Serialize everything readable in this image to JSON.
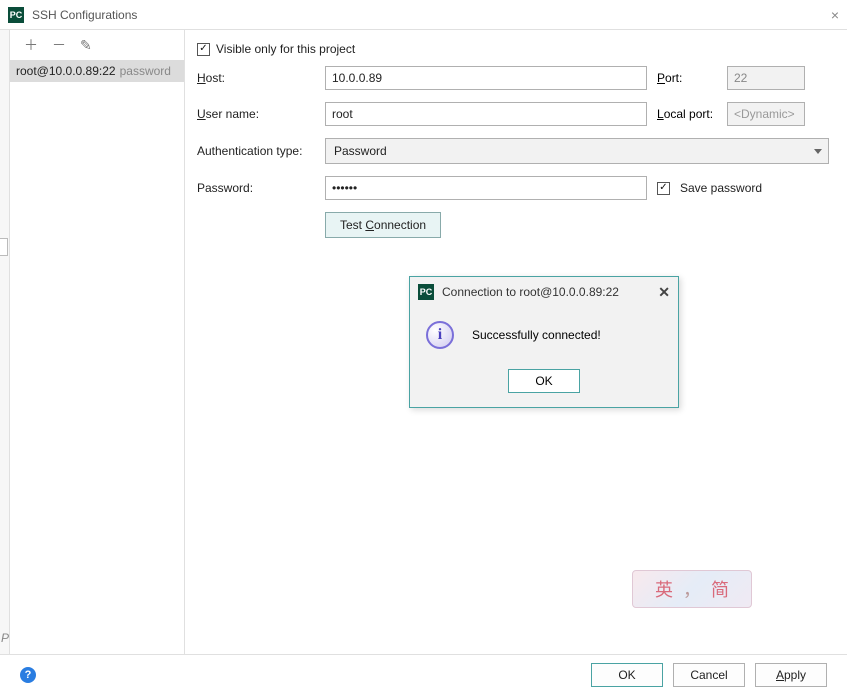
{
  "window": {
    "title": "SSH Configurations",
    "close_glyph": "×"
  },
  "app_icon_text": "PC",
  "sidebar": {
    "icons": {
      "add": "＋",
      "remove": "－",
      "edit": "✎"
    },
    "items": [
      {
        "label": "root@10.0.0.89:22",
        "suffix": "password"
      }
    ]
  },
  "form": {
    "visible_only_label": "Visible only for this project",
    "visible_only_checked": true,
    "host_label": "Host:",
    "host_value": "10.0.0.89",
    "port_label": "Port:",
    "port_value": "22",
    "user_label": "User name:",
    "user_value": "root",
    "localport_label": "Local port:",
    "localport_placeholder": "<Dynamic>",
    "authtype_label": "Authentication type:",
    "authtype_value": "Password",
    "password_label": "Password:",
    "password_masked": "••••••",
    "save_password_label": "Save password",
    "save_password_checked": true,
    "test_connection_label": "Test Connection"
  },
  "popup": {
    "title": "Connection to root@10.0.0.89:22",
    "message": "Successfully connected!",
    "ok_label": "OK",
    "close_glyph": "✕"
  },
  "ime": {
    "left": "英",
    "sep": "，",
    "right": "简"
  },
  "bottom": {
    "ok": "OK",
    "cancel": "Cancel",
    "apply": "Apply"
  }
}
